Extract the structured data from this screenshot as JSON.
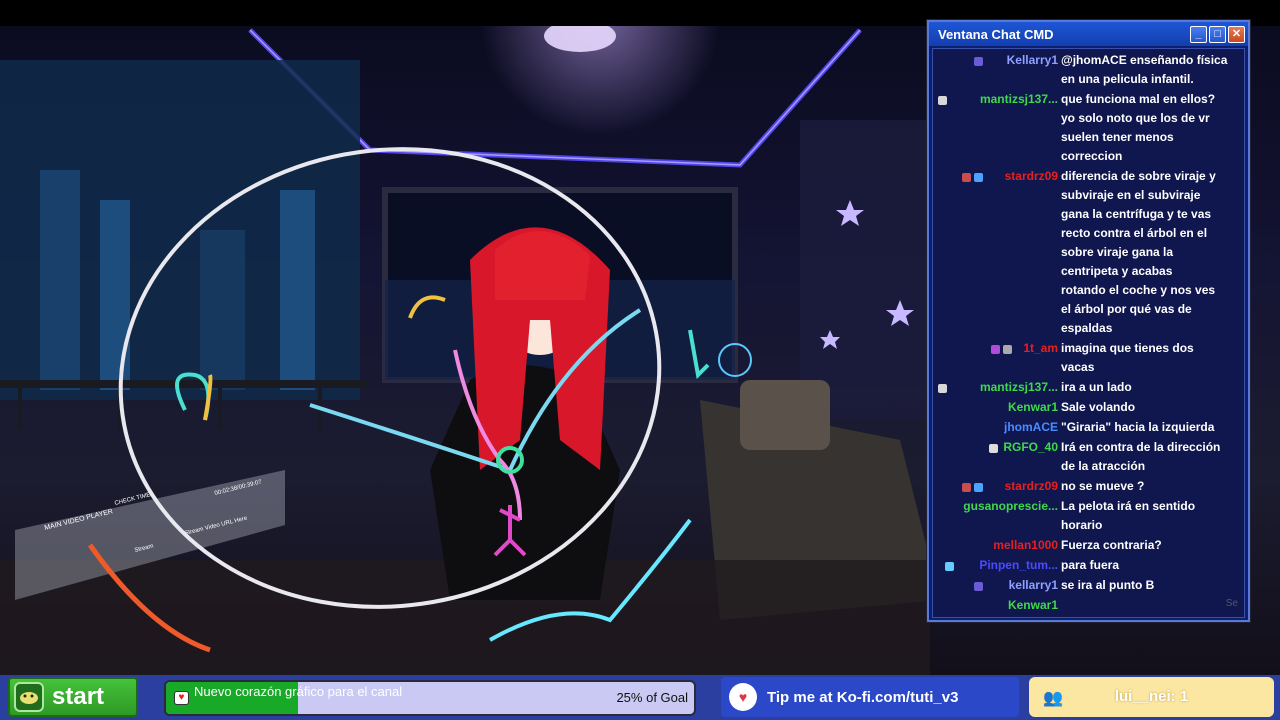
{
  "chat_window": {
    "title": "Ventana Chat CMD",
    "buttons": {
      "minimize": "_",
      "maximize": "□",
      "close": "✕"
    },
    "scroll_hint": "Se",
    "messages": [
      {
        "user": "Kellarry1",
        "user_color": "#8fa0ff",
        "badges": [
          "#6b5bd6"
        ],
        "text": "@jhomACE enseñando física\nen una pelicula infantil."
      },
      {
        "user": "mantizsj137...",
        "user_color": "#3fd84b",
        "badges": [
          "#d8d8d8"
        ],
        "text": "que funciona mal en ellos?\nyo solo noto que los de vr\nsuelen tener menos\ncorreccion"
      },
      {
        "user": "stardrz09",
        "user_color": "#e52020",
        "badges": [
          "#c84e4e",
          "#4aa3ff"
        ],
        "text": "diferencia de sobre viraje y\nsubviraje en el subviraje\ngana la centrífuga y te vas\nrecto contra el árbol en el\nsobre viraje gana la\ncentripeta y acabas\nrotando el coche y nos ves\nel árbol por qué vas de\nespaldas"
      },
      {
        "user": "1t_am",
        "user_color": "#e52020",
        "badges": [
          "#b44ad8",
          "#aaaaaa"
        ],
        "text": "imagina que tienes dos\nvacas"
      },
      {
        "user": "mantizsj137...",
        "user_color": "#3fd84b",
        "badges": [
          "#d8d8d8"
        ],
        "text": "ira a un lado"
      },
      {
        "user": "Kenwar1",
        "user_color": "#3fd84b",
        "badges": [],
        "text": "Sale volando"
      },
      {
        "user": "jhomACE",
        "user_color": "#4a8cff",
        "badges": [],
        "text": "\"Giraria\" hacia la izquierda"
      },
      {
        "user": "RGFO_40",
        "user_color": "#3fd84b",
        "badges": [
          "#dddddd"
        ],
        "text": "Irá en contra de la dirección\nde la atracción"
      },
      {
        "user": "stardrz09",
        "user_color": "#e52020",
        "badges": [
          "#c84e4e",
          "#4aa3ff"
        ],
        "text": "no se mueve ?"
      },
      {
        "user": "gusanoprescie...",
        "user_color": "#3fd84b",
        "badges": [],
        "text": "La pelota irá en sentido\nhorario"
      },
      {
        "user": "mellan1000",
        "user_color": "#e52020",
        "badges": [],
        "text": "Fuerza contraria?"
      },
      {
        "user": "Pinpen_tum...",
        "user_color": "#4a4aff",
        "badges": [
          "#66ccff"
        ],
        "text": "para fuera"
      },
      {
        "user": "kellarry1",
        "user_color": "#8fa0ff",
        "badges": [
          "#6b5bd6"
        ],
        "text": "se ira al punto B"
      },
      {
        "user": "Kenwar1",
        "user_color": "#3fd84b",
        "badges": [],
        "text": ""
      }
    ]
  },
  "scene": {
    "monitor_texts": [
      "MAIN VIDEO PLAYER",
      "CHECK TIME",
      "00:02:38/00:39:07",
      "Stream",
      "Stream Video URL Here"
    ]
  },
  "bottom_bar": {
    "start_label": "start",
    "goal_text": "Nuevo corazón gráfico para el canal",
    "goal_percent_label": "25% of Goal",
    "goal_progress": 0.25,
    "kofi_text": "Tip me at Ko-fi.com/tuti_v3",
    "viewer_text": "lui__nei: 1"
  },
  "colors": {
    "chat_bg": "#0c1f6e",
    "titlebar": "#1e56d6",
    "start_green": "#45c23a",
    "goal_fill": "#19a928",
    "kofi_blue": "#2a48c8",
    "viewer_yellow": "#fbe7a2"
  }
}
